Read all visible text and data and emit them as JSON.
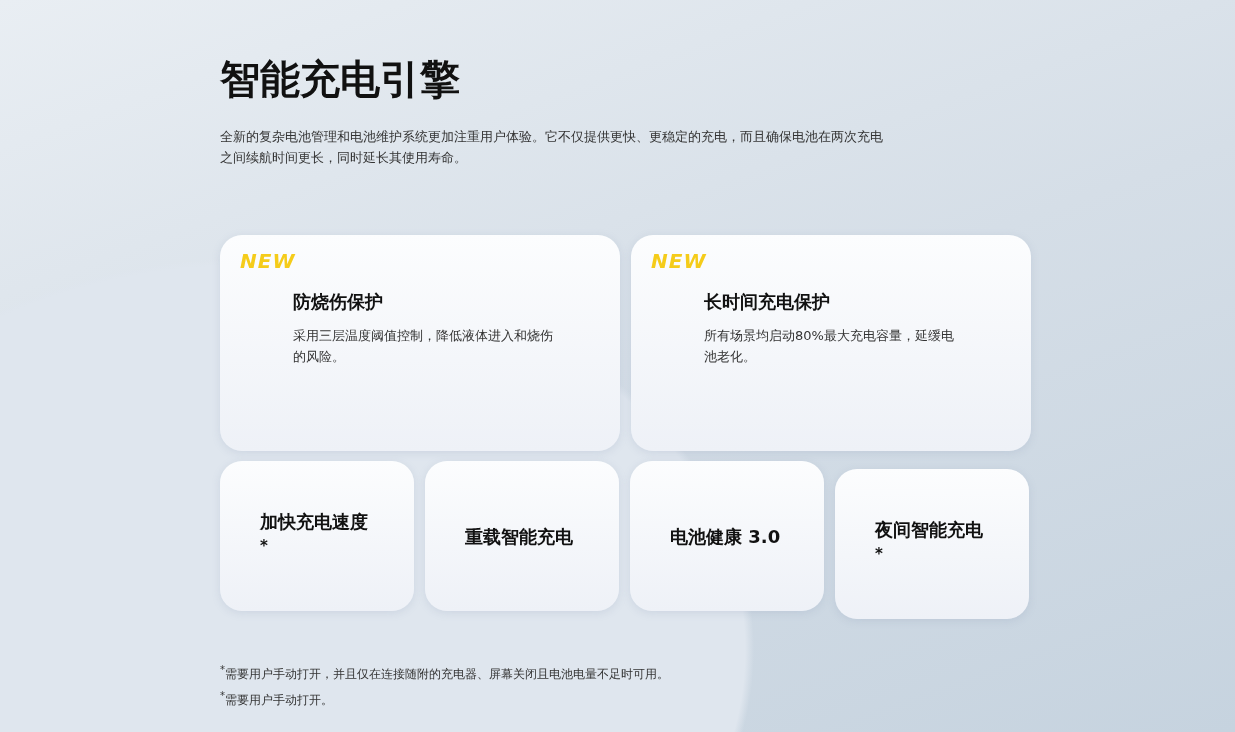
{
  "title": "智能充电引擎",
  "intro": "全新的复杂电池管理和电池维护系统更加注重用户体验。它不仅提供更快、更稳定的充电，而且确保电池在两次充电之间续航时间更长，同时延长其使用寿命。",
  "featured": [
    {
      "badge": "NEW",
      "title": "防烧伤保护",
      "text": "采用三层温度阈值控制，降低液体进入和烧伤的风险。"
    },
    {
      "badge": "NEW",
      "title": "长时间充电保护",
      "text": "所有场景均启动80%最大充电容量，延缓电池老化。"
    }
  ],
  "features": [
    {
      "title": "加快充电速度$^{*}$"
    },
    {
      "title": "重载智能充电"
    },
    {
      "title": "电池健康 3.0"
    },
    {
      "title": "夜间智能充电$^{*}$"
    }
  ],
  "footnotes": [
    "$^{*}$需要用户手动打开，并且仅在连接随附的充电器、屏幕关闭且电池电量不足时可用。",
    "$^{*}$需要用户手动打开。"
  ]
}
